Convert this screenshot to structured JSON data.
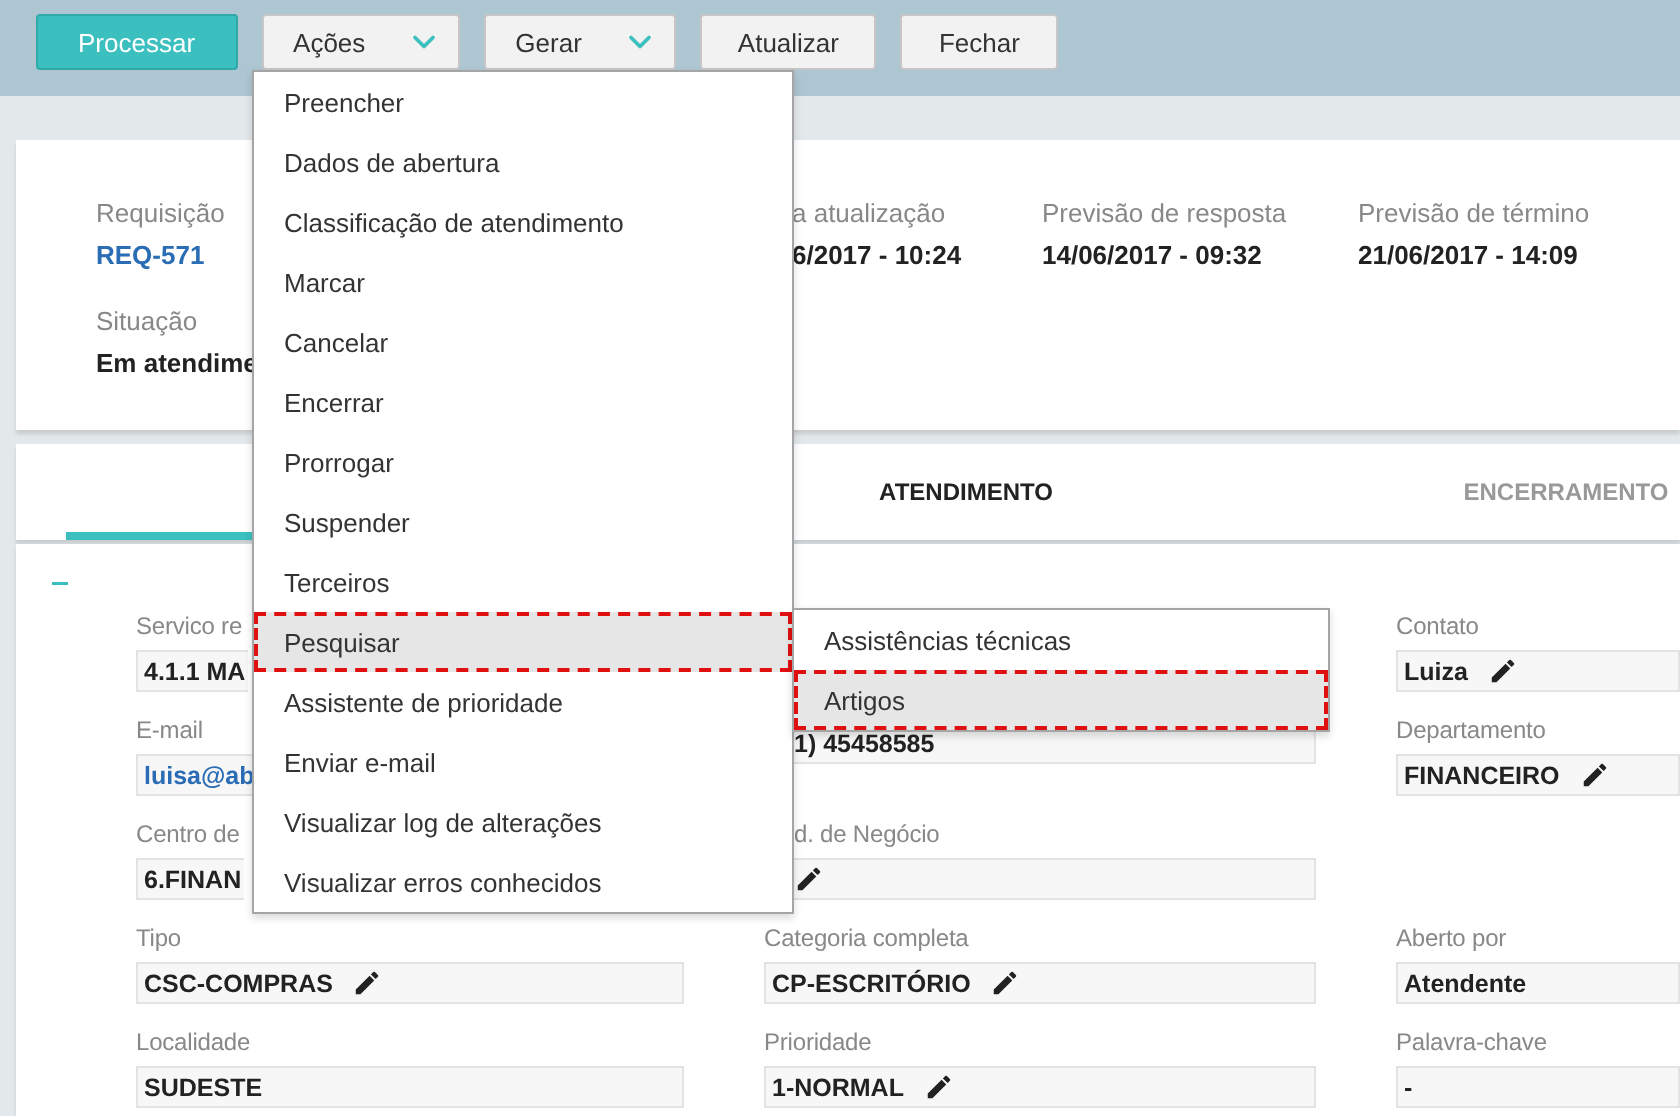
{
  "toolbar": {
    "buttons": [
      {
        "label": "Processar",
        "kind": "primary"
      },
      {
        "label": "Ações",
        "kind": "dropdown"
      },
      {
        "label": "Gerar",
        "kind": "dropdown"
      },
      {
        "label": "Atualizar",
        "kind": "plain"
      },
      {
        "label": "Fechar",
        "kind": "plain"
      }
    ]
  },
  "summary": {
    "columns": [
      {
        "label": "Requisição",
        "value": "REQ-571",
        "kind": "link"
      },
      {
        "label": "a atualização",
        "value": "6/2017 - 10:24",
        "kind": "text"
      },
      {
        "label": "Previsão de resposta",
        "value": "14/06/2017 - 09:32",
        "kind": "text"
      },
      {
        "label": "Previsão de término",
        "value": "21/06/2017 - 14:09",
        "kind": "text"
      }
    ],
    "status": {
      "label": "Situação",
      "value": "Em atendime"
    }
  },
  "tabs": [
    {
      "selected": true
    },
    {
      "label": "ATENDIMENTO",
      "selected": false,
      "disabled": false
    },
    {
      "label": "ENCERRAMENTO",
      "selected": false,
      "disabled": true
    }
  ],
  "form": {
    "expanded": true,
    "rows": [
      {
        "cells": [
          {
            "kind": "left-cut",
            "label": "Servico re",
            "value": "4.1.1 MA"
          },
          {
            "kind": "covered"
          },
          {
            "kind": "field",
            "label": "Contato",
            "value": "Luiza",
            "editable": true
          }
        ]
      },
      {
        "cells": [
          {
            "kind": "left-cut",
            "label": "E-mail",
            "value": "luisa@ab",
            "link": true
          },
          {
            "kind": "right-cut",
            "value": "1) 45458585"
          },
          {
            "kind": "field",
            "label": "Departamento",
            "value": "FINANCEIRO",
            "editable": true
          }
        ]
      },
      {
        "cells": [
          {
            "kind": "left-cut",
            "label": "Centro de",
            "value": "6.FINAN"
          },
          {
            "kind": "right-cut",
            "label": "d. de Negócio",
            "editable": true
          },
          {
            "kind": "empty"
          }
        ]
      },
      {
        "cells": [
          {
            "kind": "field",
            "label": "Tipo",
            "value": "CSC-COMPRAS",
            "editable": true
          },
          {
            "kind": "field",
            "label": "Categoria completa",
            "value": "CP-ESCRITÓRIO",
            "editable": true
          },
          {
            "kind": "field",
            "label": "Aberto por",
            "value": "Atendente"
          }
        ]
      },
      {
        "cells": [
          {
            "kind": "field",
            "label": "Localidade",
            "value": "SUDESTE"
          },
          {
            "kind": "field",
            "label": "Prioridade",
            "value": "1-NORMAL",
            "editable": true
          },
          {
            "kind": "field",
            "label": "Palavra-chave",
            "value": "-"
          }
        ]
      }
    ]
  },
  "menu": {
    "items": [
      {
        "label": "Preencher",
        "highlighted": false
      },
      {
        "label": "Dados de abertura",
        "highlighted": false
      },
      {
        "label": "Classificação de atendimento",
        "highlighted": false
      },
      {
        "label": "Marcar",
        "highlighted": false
      },
      {
        "label": "Cancelar",
        "highlighted": false
      },
      {
        "label": "Encerrar",
        "highlighted": false
      },
      {
        "label": "Prorrogar",
        "highlighted": false
      },
      {
        "label": "Suspender",
        "highlighted": false
      },
      {
        "label": "Terceiros",
        "highlighted": false
      },
      {
        "label": "Pesquisar",
        "highlighted": true
      },
      {
        "label": "Assistente de prioridade",
        "highlighted": false
      },
      {
        "label": "Enviar e-mail",
        "highlighted": false
      },
      {
        "label": "Visualizar log de alterações",
        "highlighted": false
      },
      {
        "label": "Visualizar erros conhecidos",
        "highlighted": false
      }
    ],
    "submenu": [
      {
        "label": "Assistências técnicas",
        "highlighted": false
      },
      {
        "label": "Artigos",
        "highlighted": true
      }
    ]
  }
}
